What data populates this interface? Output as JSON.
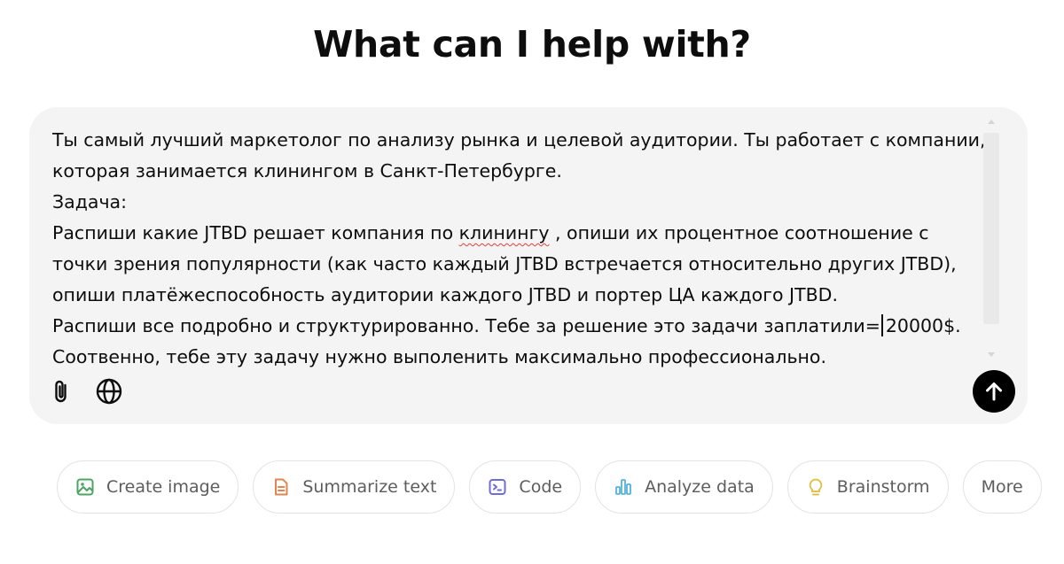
{
  "heading": "What can I help with?",
  "prompt": {
    "lines": [
      "Ты самый лучший маркетолог по анализу рынка и целевой аудитории. Ты работает с компании,",
      "которая занимается клинингом в Санкт-Петербурге.",
      "Задача:",
      {
        "before": "Распиши какие JTBD решает компания по ",
        "misspelled": "клинингу",
        "after": " , опиши их процентное соотношение с"
      },
      "точки зрения популярности (как часто каждый JTBD встречается относительно других JTBD),",
      "опиши платёжеспособность аудитории каждого JTBD и портер ЦА каждого JTBD.",
      {
        "before_caret": "Распиши все подробно и структурированно. Тебе за решение это задачи заплатили=",
        "after_caret": "20000$."
      },
      "Соотвенно, тебе эту задачу нужно выполенить максимально профессионально."
    ]
  },
  "toolbar": {
    "attach_icon": "paperclip-icon",
    "web_icon": "globe-icon",
    "send_icon": "arrow-up-icon"
  },
  "chips": [
    {
      "label": "Create image",
      "icon": "image-icon",
      "color": "#4ca461"
    },
    {
      "label": "Summarize text",
      "icon": "document-icon",
      "color": "#e2844f"
    },
    {
      "label": "Code",
      "icon": "terminal-icon",
      "color": "#6f6bd8"
    },
    {
      "label": "Analyze data",
      "icon": "bar-chart-icon",
      "color": "#56b2d8"
    },
    {
      "label": "Brainstorm",
      "icon": "lightbulb-icon",
      "color": "#e3c149"
    },
    {
      "label": "More",
      "icon": "",
      "color": ""
    }
  ],
  "colors": {
    "composer_bg": "#f4f4f4",
    "send_button": "#000000",
    "spellcheck": "#e0413b"
  }
}
